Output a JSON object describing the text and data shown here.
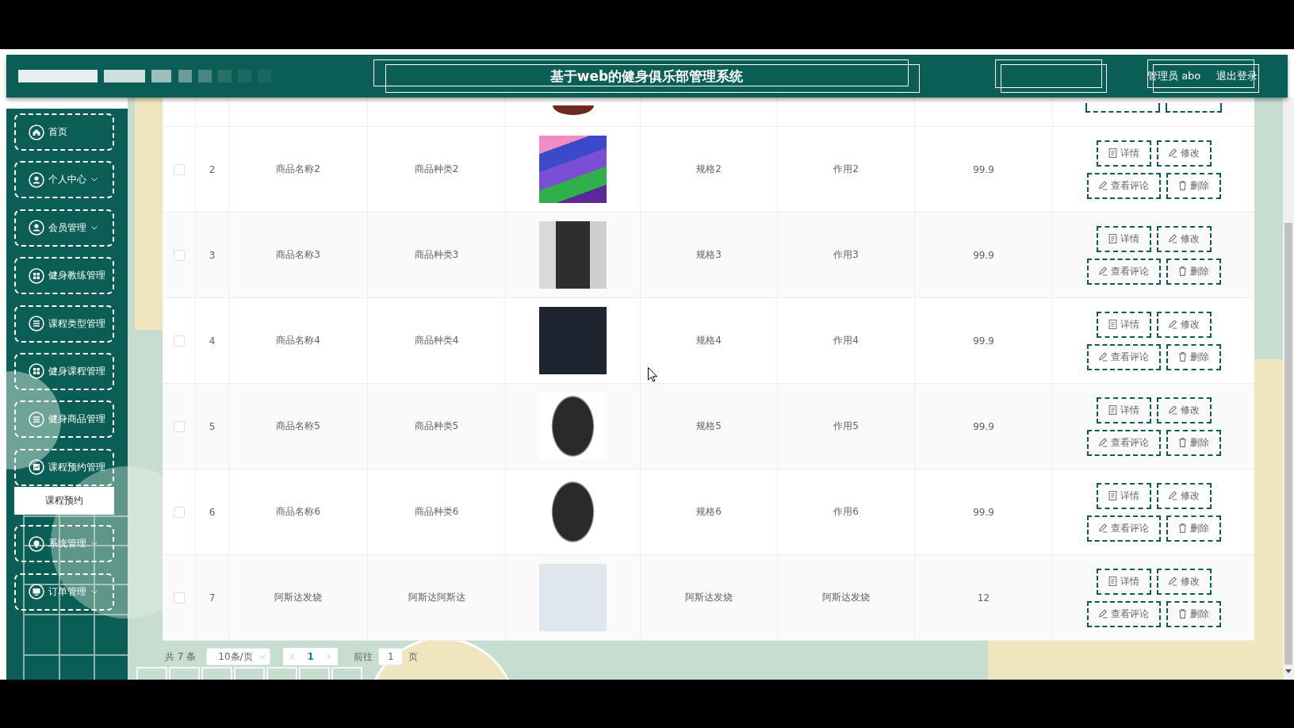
{
  "header": {
    "title": "基于web的健身俱乐部管理系统",
    "user": "管理员 abo",
    "logout": "退出登录"
  },
  "sidebar": {
    "items": [
      {
        "label": "首页"
      },
      {
        "label": "个人中心",
        "expanded": false
      },
      {
        "label": "会员管理",
        "expanded": false
      },
      {
        "label": "健身教练管理"
      },
      {
        "label": "课程类型管理"
      },
      {
        "label": "健身课程管理"
      },
      {
        "label": "健身商品管理"
      },
      {
        "label": "课程预约管理",
        "expanded": true,
        "children": [
          {
            "label": "课程预约"
          }
        ]
      },
      {
        "label": "系统管理",
        "expanded": false
      },
      {
        "label": "订单管理",
        "expanded": false
      }
    ]
  },
  "table": {
    "rows": [
      {
        "checked": false,
        "cells": [
          "2",
          "商品名称2",
          "商品种类2",
          "规格2",
          "作用2",
          "99.9"
        ],
        "actions": [
          "详情",
          "修改",
          "查看评论",
          "删除"
        ]
      },
      {
        "checked": false,
        "cells": [
          "3",
          "商品名称3",
          "商品种类3",
          "规格3",
          "作用3",
          "99.9"
        ],
        "actions": [
          "详情",
          "修改",
          "查看评论",
          "删除"
        ]
      },
      {
        "checked": false,
        "cells": [
          "4",
          "商品名称4",
          "商品种类4",
          "规格4",
          "作用4",
          "99.9"
        ],
        "actions": [
          "详情",
          "修改",
          "查看评论",
          "删除"
        ]
      },
      {
        "checked": false,
        "cells": [
          "5",
          "商品名称5",
          "商品种类5",
          "规格5",
          "作用5",
          "99.9"
        ],
        "actions": [
          "详情",
          "修改",
          "查看评论",
          "删除"
        ]
      },
      {
        "checked": false,
        "cells": [
          "6",
          "商品名称6",
          "商品种类6",
          "规格6",
          "作用6",
          "99.9"
        ],
        "actions": [
          "详情",
          "修改",
          "查看评论",
          "删除"
        ]
      },
      {
        "checked": false,
        "cells": [
          "7",
          "阿斯达发烧",
          "阿斯达阿斯达",
          "阿斯达发烧",
          "阿斯达发烧",
          "12"
        ],
        "actions": [
          "详情",
          "修改",
          "查看评论",
          "删除"
        ]
      }
    ]
  },
  "pagination": {
    "total": "共 7 条",
    "page_size": "10条/页",
    "prev_disabled": true,
    "pages": [
      {
        "label": "1",
        "selected": true
      }
    ],
    "next_disabled": true,
    "goto_label": "前往",
    "goto_value": "1",
    "goto_unit": "页"
  }
}
